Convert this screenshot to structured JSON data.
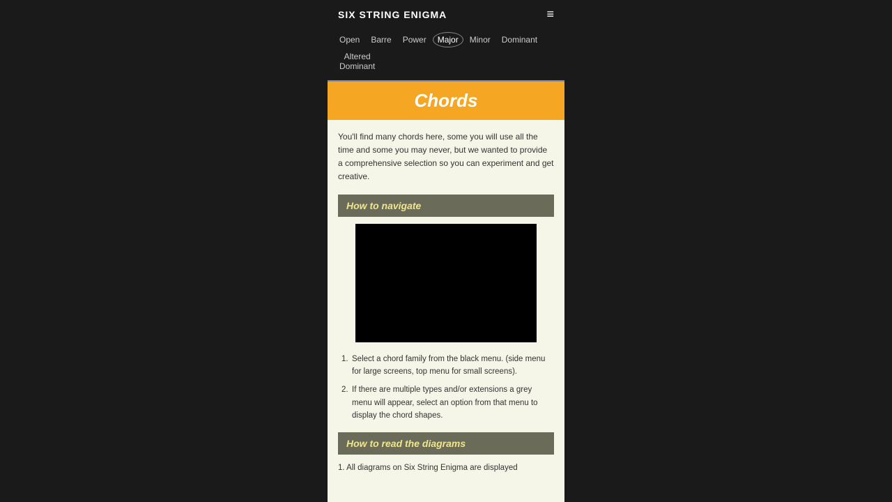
{
  "header": {
    "site_title": "SIX STRING ENIGMA",
    "hamburger": "≡"
  },
  "nav": {
    "items": [
      {
        "label": "Open",
        "active": false
      },
      {
        "label": "Barre",
        "active": false
      },
      {
        "label": "Power",
        "active": false
      },
      {
        "label": "Major",
        "active": true
      },
      {
        "label": "Minor",
        "active": false
      },
      {
        "label": "Dominant",
        "active": false
      },
      {
        "label": "Altered\nDominant",
        "active": false,
        "multiline": true
      }
    ]
  },
  "chords_banner": {
    "title": "Chords"
  },
  "intro": {
    "text": "You'll find many chords here, some you will use all the time and some you may never, but we wanted to provide a comprehensive selection so you can experiment and get creative."
  },
  "how_to_navigate": {
    "heading": "How to navigate",
    "steps": [
      {
        "number": "1.",
        "text": "Select a chord family from the black menu. (side menu for large screens, top menu for small screens)."
      },
      {
        "number": "2.",
        "text": "If there are multiple types and/or extensions a grey menu will appear, select an option from that menu to display the chord shapes."
      }
    ]
  },
  "how_to_read": {
    "heading": "How to read the diagrams",
    "text": "1. All diagrams on Six String Enigma are displayed"
  }
}
